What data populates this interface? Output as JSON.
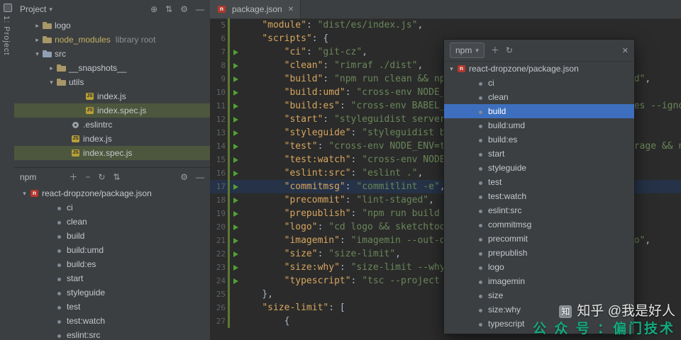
{
  "glyphs": {
    "caret": "▾",
    "arrow_right": "▸",
    "arrow_down": "▾",
    "locate": "⊕",
    "sort": "⇅",
    "gear": "⚙",
    "hide": "—",
    "plus": "＋",
    "minus": "−",
    "refresh": "↻",
    "close": "✕"
  },
  "stripe": {
    "label": "1: Project"
  },
  "project": {
    "title": "Project",
    "items": [
      {
        "label": "logo",
        "icon": "folder",
        "arrow": "right",
        "indent": 0
      },
      {
        "label": "node_modules",
        "icon": "folder",
        "arrow": "right",
        "indent": 0,
        "excluded": true,
        "suffix": "library root"
      },
      {
        "label": "src",
        "icon": "folder-src",
        "arrow": "down",
        "indent": 0
      },
      {
        "label": "__snapshots__",
        "icon": "folder",
        "arrow": "right",
        "indent": 1
      },
      {
        "label": "utils",
        "icon": "folder",
        "arrow": "down",
        "indent": 1
      },
      {
        "label": "index.js",
        "icon": "js",
        "arrow": "none",
        "indent": 3
      },
      {
        "label": "index.spec.js",
        "icon": "js",
        "arrow": "none",
        "indent": 3,
        "selected": true
      },
      {
        "label": ".eslintrc",
        "icon": "cfg",
        "arrow": "none",
        "indent": 2
      },
      {
        "label": "index.js",
        "icon": "js",
        "arrow": "none",
        "indent": 2
      },
      {
        "label": "index.spec.js",
        "icon": "js",
        "arrow": "none",
        "indent": 2,
        "selected": true
      }
    ]
  },
  "npm_panel": {
    "title": "npm",
    "root": "react-dropzone/package.json",
    "scripts": [
      "ci",
      "clean",
      "build",
      "build:umd",
      "build:es",
      "start",
      "styleguide",
      "test",
      "test:watch",
      "eslint:src"
    ]
  },
  "editor": {
    "tab_label": "package.json",
    "caret_line": 17,
    "lines": [
      {
        "n": 5,
        "indent": 4,
        "run": false,
        "tokens": [
          [
            "k",
            "\"module\""
          ],
          [
            "p",
            ": "
          ],
          [
            "s",
            "\"dist/es/index.js\""
          ],
          [
            "p",
            ","
          ]
        ]
      },
      {
        "n": 6,
        "indent": 4,
        "run": false,
        "tokens": [
          [
            "k",
            "\"scripts\""
          ],
          [
            "p",
            ": {"
          ]
        ]
      },
      {
        "n": 7,
        "indent": 8,
        "run": true,
        "tokens": [
          [
            "k",
            "\"ci\""
          ],
          [
            "p",
            ": "
          ],
          [
            "s",
            "\"git-cz\""
          ],
          [
            "p",
            ","
          ]
        ]
      },
      {
        "n": 8,
        "indent": 8,
        "run": true,
        "tokens": [
          [
            "k",
            "\"clean\""
          ],
          [
            "p",
            ": "
          ],
          [
            "s",
            "\"rimraf ./dist\""
          ],
          [
            "p",
            ","
          ]
        ]
      },
      {
        "n": 9,
        "indent": 8,
        "run": true,
        "tokens": [
          [
            "k",
            "\"build\""
          ],
          [
            "p",
            ": "
          ],
          [
            "s",
            "\"npm run clean && npm run build:es && npm run build:umd\""
          ],
          [
            "p",
            ","
          ]
        ]
      },
      {
        "n": 10,
        "indent": 8,
        "run": true,
        "tokens": [
          [
            "k",
            "\"build:umd\""
          ],
          [
            "p",
            ": "
          ],
          [
            "s",
            "\"cross-env NODE_ENV=production webpack --bail\""
          ],
          [
            "p",
            ","
          ]
        ]
      },
      {
        "n": 11,
        "indent": 8,
        "run": true,
        "tokens": [
          [
            "k",
            "\"build:es\""
          ],
          [
            "p",
            ": "
          ],
          [
            "s",
            "\"cross-env BABEL_ENV=es babel src --out-dir ./dist/es --ignore *.spec.js\""
          ],
          [
            "p",
            ","
          ]
        ]
      },
      {
        "n": 12,
        "indent": 8,
        "run": true,
        "tokens": [
          [
            "k",
            "\"start\""
          ],
          [
            "p",
            ": "
          ],
          [
            "s",
            "\"styleguidist server\""
          ],
          [
            "p",
            ","
          ]
        ]
      },
      {
        "n": 13,
        "indent": 8,
        "run": true,
        "tokens": [
          [
            "k",
            "\"styleguide\""
          ],
          [
            "p",
            ": "
          ],
          [
            "s",
            "\"styleguidist build\""
          ],
          [
            "p",
            ","
          ]
        ]
      },
      {
        "n": 14,
        "indent": 8,
        "run": true,
        "tokens": [
          [
            "k",
            "\"test\""
          ],
          [
            "p",
            ": "
          ],
          [
            "s",
            "\"cross-env NODE_ENV=test BABEL_ENV=commonjs jest --coverage && npm run size\""
          ],
          [
            "p",
            ","
          ]
        ]
      },
      {
        "n": 15,
        "indent": 8,
        "run": true,
        "tokens": [
          [
            "k",
            "\"test:watch\""
          ],
          [
            "p",
            ": "
          ],
          [
            "s",
            "\"cross-env NODE_ENV=test jest --watch\""
          ],
          [
            "p",
            ","
          ]
        ]
      },
      {
        "n": 16,
        "indent": 8,
        "run": true,
        "tokens": [
          [
            "k",
            "\"eslint:src\""
          ],
          [
            "p",
            ": "
          ],
          [
            "s",
            "\"eslint .\""
          ],
          [
            "p",
            ","
          ]
        ]
      },
      {
        "n": 17,
        "indent": 8,
        "run": true,
        "tokens": [
          [
            "k",
            "\"commitmsg\""
          ],
          [
            "p",
            ": "
          ],
          [
            "s",
            "\"commitlint -e\""
          ],
          [
            "p",
            ","
          ]
        ]
      },
      {
        "n": 18,
        "indent": 8,
        "run": true,
        "tokens": [
          [
            "k",
            "\"precommit\""
          ],
          [
            "p",
            ": "
          ],
          [
            "s",
            "\"lint-staged\""
          ],
          [
            "p",
            ","
          ]
        ]
      },
      {
        "n": 19,
        "indent": 8,
        "run": true,
        "tokens": [
          [
            "k",
            "\"prepublish\""
          ],
          [
            "p",
            ": "
          ],
          [
            "s",
            "\"npm run build && npm run size\""
          ],
          [
            "p",
            ","
          ]
        ]
      },
      {
        "n": 20,
        "indent": 8,
        "run": true,
        "tokens": [
          [
            "k",
            "\"logo\""
          ],
          [
            "p",
            ": "
          ],
          [
            "s",
            "\"cd logo && sketchtool export artboards\""
          ],
          [
            "p",
            ","
          ]
        ]
      },
      {
        "n": 21,
        "indent": 8,
        "run": true,
        "tokens": [
          [
            "k",
            "\"imagemin\""
          ],
          [
            "p",
            ": "
          ],
          [
            "s",
            "\"imagemin --out-dir=./logo --plugin=webp ./logo/logo\""
          ],
          [
            "p",
            ","
          ]
        ]
      },
      {
        "n": 22,
        "indent": 8,
        "run": true,
        "tokens": [
          [
            "k",
            "\"size\""
          ],
          [
            "p",
            ": "
          ],
          [
            "s",
            "\"size-limit\""
          ],
          [
            "p",
            ","
          ]
        ]
      },
      {
        "n": 23,
        "indent": 8,
        "run": true,
        "tokens": [
          [
            "k",
            "\"size:why\""
          ],
          [
            "p",
            ": "
          ],
          [
            "s",
            "\"size-limit --why\""
          ],
          [
            "p",
            ","
          ]
        ]
      },
      {
        "n": 24,
        "indent": 8,
        "run": true,
        "tokens": [
          [
            "k",
            "\"typescript\""
          ],
          [
            "p",
            ": "
          ],
          [
            "s",
            "\"tsc --project ./typings/tests\""
          ],
          [
            "p",
            ","
          ]
        ]
      },
      {
        "n": 25,
        "indent": 4,
        "run": false,
        "tokens": [
          [
            "p",
            "},"
          ]
        ]
      },
      {
        "n": 26,
        "indent": 4,
        "run": false,
        "tokens": [
          [
            "k",
            "\"size-limit\""
          ],
          [
            "p",
            ": ["
          ]
        ]
      },
      {
        "n": 27,
        "indent": 8,
        "run": false,
        "tokens": [
          [
            "p",
            "{"
          ]
        ]
      }
    ]
  },
  "popup": {
    "selector_label": "npm",
    "root": "react-dropzone/package.json",
    "selected": "build",
    "scripts": [
      "ci",
      "clean",
      "build",
      "build:umd",
      "build:es",
      "start",
      "styleguide",
      "test",
      "test:watch",
      "eslint:src",
      "commitmsg",
      "precommit",
      "prepublish",
      "logo",
      "imagemin",
      "size",
      "size:why",
      "typescript"
    ]
  },
  "watermark": {
    "logo_text": "知",
    "line1": "知乎 @我是好人",
    "line2": "公 众 号 ：偏门技术"
  }
}
